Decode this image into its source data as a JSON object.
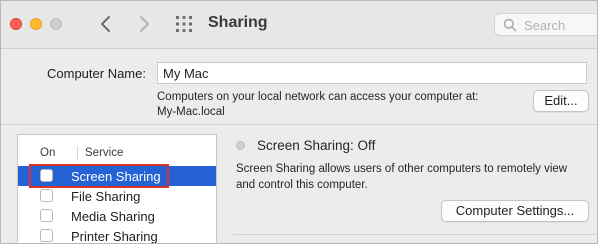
{
  "window": {
    "title": "Sharing"
  },
  "search": {
    "placeholder": "Search"
  },
  "computer_name": {
    "label": "Computer Name:",
    "value": "My Mac",
    "info_line1": "Computers on your local network can access your computer at:",
    "info_line2": "My-Mac.local",
    "edit_label": "Edit..."
  },
  "services": {
    "header_on": "On",
    "header_service": "Service",
    "items": [
      {
        "label": "Screen Sharing",
        "checked": false,
        "selected": true
      },
      {
        "label": "File Sharing",
        "checked": false,
        "selected": false
      },
      {
        "label": "Media Sharing",
        "checked": false,
        "selected": false
      },
      {
        "label": "Printer Sharing",
        "checked": false,
        "selected": false
      }
    ]
  },
  "detail": {
    "status": "Screen Sharing: Off",
    "description_line1": "Screen Sharing allows users of other computers to remotely view",
    "description_line2": "and control this computer.",
    "settings_button": "Computer Settings..."
  },
  "colors": {
    "selection": "#2462d6",
    "highlight_box": "#d9322b",
    "close": "#fe5f57",
    "minimize": "#febc2e"
  },
  "icons": [
    "chevron-left-icon",
    "chevron-right-icon",
    "grid-icon",
    "search-icon"
  ]
}
